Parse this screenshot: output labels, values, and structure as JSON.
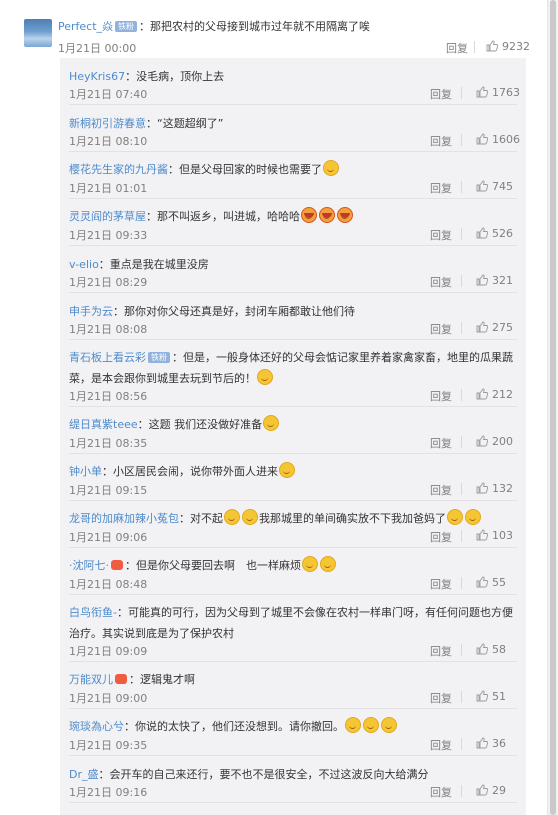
{
  "top_comment": {
    "username": "Perfect_焱",
    "badge": "铁粉",
    "text": "：那把农村的父母接到城市过年就不用隔离了唉",
    "date": "1月21日 00:00",
    "reply_label": "回复",
    "likes": "9232"
  },
  "replies": [
    {
      "username": "HeyKris67",
      "badge": "",
      "text": "：没毛病，顶你上去",
      "date": "1月21日 07:40",
      "reply_label": "回复",
      "likes": "1763",
      "emoji": ""
    },
    {
      "username": "新桐初引游春意",
      "badge": "",
      "text": "：“这题超纲了”",
      "date": "1月21日 08:10",
      "reply_label": "回复",
      "likes": "1606",
      "emoji": ""
    },
    {
      "username": "樱花先生家的九丹酱",
      "badge": "",
      "text": "：但是父母回家的时候也需要了",
      "date": "1月21日 01:01",
      "reply_label": "回复",
      "likes": "745",
      "emoji": "laugh"
    },
    {
      "username": "灵灵阎的茅草屋",
      "badge": "",
      "text": "：那不叫返乡，叫进城，哈哈哈",
      "date": "1月21日 09:33",
      "reply_label": "回复",
      "likes": "526",
      "emoji": "red3"
    },
    {
      "username": "v-elio",
      "badge": "",
      "text": "：重点是我在城里没房",
      "date": "1月21日 08:29",
      "reply_label": "回复",
      "likes": "321",
      "emoji": ""
    },
    {
      "username": "申手为云",
      "badge": "",
      "text": "：那你对你父母还真是好，封闭车厢都敢让他们待",
      "date": "1月21日 08:08",
      "reply_label": "回复",
      "likes": "275",
      "emoji": ""
    },
    {
      "username": "青石板上看云彩",
      "badge": "铁粉",
      "text": "：但是，一般身体还好的父母会惦记家里养着家禽家畜，地里的瓜果蔬菜，是本会跟你到城里去玩到节后的！",
      "date": "1月21日 08:56",
      "reply_label": "回复",
      "likes": "212",
      "emoji": "laugh"
    },
    {
      "username": "缇日真紫teee",
      "badge": "",
      "text": "：这题 我们还没做好准备",
      "date": "1月21日 08:35",
      "reply_label": "回复",
      "likes": "200",
      "emoji": "think"
    },
    {
      "username": "钟小单",
      "badge": "",
      "text": "：小区居民会闹，说你带外面人进来",
      "date": "1月21日 09:15",
      "reply_label": "回复",
      "likes": "132",
      "emoji": "laugh"
    },
    {
      "username": "龙哥的加麻加辣小菟包",
      "badge": "",
      "text": "：对不起",
      "text2": "我那城里的单间确实放不下我加爸妈了",
      "date": "1月21日 09:06",
      "reply_label": "回复",
      "likes": "103",
      "emoji": "mid"
    },
    {
      "username": "·沈阿七·",
      "badge": "dot",
      "text": "：但是你父母要回去啊　也一样麻烦",
      "date": "1月21日 08:48",
      "reply_label": "回复",
      "likes": "55",
      "emoji": "laugh2"
    },
    {
      "username": "白鸟衔鱼-",
      "badge": "",
      "text": "：可能真的可行，因为父母到了城里不会像在农村一样串门呀，有任何问题也方便治疗。其实说到底是为了保护农村",
      "date": "1月21日 09:09",
      "reply_label": "回复",
      "likes": "58",
      "emoji": ""
    },
    {
      "username": "万能双儿",
      "badge": "dot",
      "text": "：逻辑鬼才啊",
      "date": "1月21日 09:00",
      "reply_label": "回复",
      "likes": "51",
      "emoji": ""
    },
    {
      "username": "琬琰為心兮",
      "badge": "",
      "text": "：你说的太快了，他们还没想到。请你撤回。",
      "date": "1月21日 09:35",
      "reply_label": "回复",
      "likes": "36",
      "emoji": "three"
    },
    {
      "username": "Dr_盛",
      "badge": "",
      "text": "：会开车的自己来还行，要不也不是很安全，不过这波反向大给满分",
      "date": "1月21日 09:16",
      "reply_label": "回复",
      "likes": "29",
      "emoji": ""
    }
  ],
  "icons": {
    "like": "thumbs-up-icon",
    "emoji": "emoji-icon"
  },
  "colors": {
    "username": "#eb7350",
    "username_alt": "#4e8bca",
    "meta": "#808080",
    "reply_bg": "#f2f2f5"
  }
}
